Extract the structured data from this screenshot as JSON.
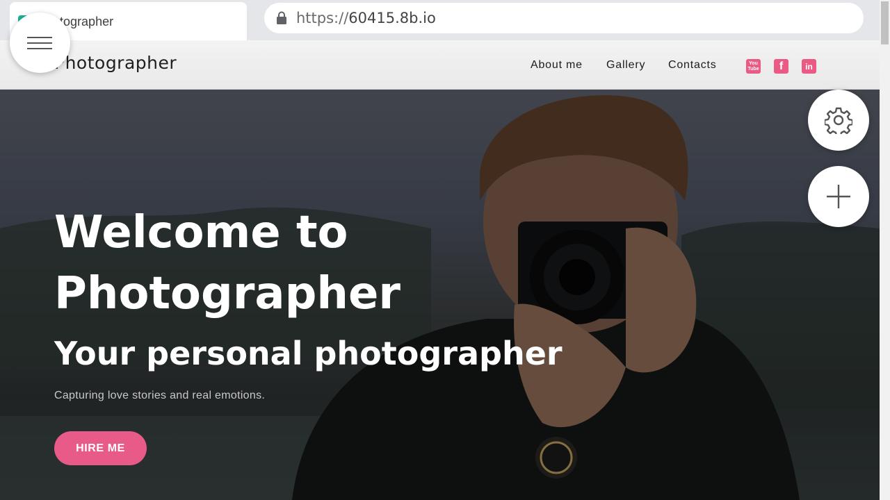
{
  "browser": {
    "tab_title": "Photographer",
    "url_prefix": "https://",
    "url_host": "60415.8b.io"
  },
  "navbar": {
    "brand": "Photographer",
    "links": [
      "About me",
      "Gallery",
      "Contacts"
    ],
    "social_icons": [
      "youtube-icon",
      "facebook-icon",
      "linkedin-icon"
    ],
    "youtube_glyph_top": "You",
    "youtube_glyph_bottom": "Tube",
    "facebook_glyph": "f",
    "linkedin_glyph": "in"
  },
  "hero": {
    "title_line1": "Welcome to",
    "title_line2": "Photographer",
    "subtitle": "Your personal photographer",
    "description": "Capturing love stories and real emotions.",
    "cta_label": "HIRE ME"
  },
  "colors": {
    "accent": "#e85b88",
    "social": "#ea5a85",
    "navbar_bg": "#efefef",
    "hero_text": "#ffffff"
  },
  "floating_buttons": [
    "menu-icon",
    "gear-icon",
    "plus-icon"
  ]
}
